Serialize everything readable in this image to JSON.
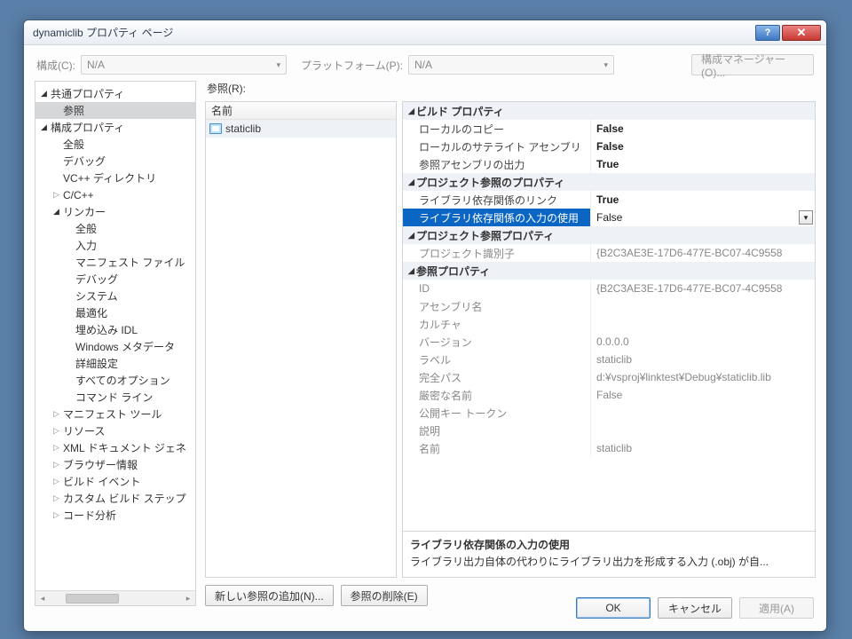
{
  "window": {
    "title": "dynamiclib プロパティ ページ"
  },
  "top": {
    "config_label": "構成(C):",
    "config_value": "N/A",
    "platform_label": "プラットフォーム(P):",
    "platform_value": "N/A",
    "configmgr": "構成マネージャー(O)..."
  },
  "tree": [
    {
      "d": 0,
      "exp": "exp",
      "label": "共通プロパティ"
    },
    {
      "d": 1,
      "exp": "none",
      "label": "参照",
      "sel": true
    },
    {
      "d": 0,
      "exp": "exp",
      "label": "構成プロパティ"
    },
    {
      "d": 1,
      "exp": "none",
      "label": "全般"
    },
    {
      "d": 1,
      "exp": "none",
      "label": "デバッグ"
    },
    {
      "d": 1,
      "exp": "none",
      "label": "VC++ ディレクトリ"
    },
    {
      "d": 1,
      "exp": "col",
      "label": "C/C++"
    },
    {
      "d": 1,
      "exp": "exp",
      "label": "リンカー"
    },
    {
      "d": 2,
      "exp": "none",
      "label": "全般"
    },
    {
      "d": 2,
      "exp": "none",
      "label": "入力"
    },
    {
      "d": 2,
      "exp": "none",
      "label": "マニフェスト ファイル"
    },
    {
      "d": 2,
      "exp": "none",
      "label": "デバッグ"
    },
    {
      "d": 2,
      "exp": "none",
      "label": "システム"
    },
    {
      "d": 2,
      "exp": "none",
      "label": "最適化"
    },
    {
      "d": 2,
      "exp": "none",
      "label": "埋め込み IDL"
    },
    {
      "d": 2,
      "exp": "none",
      "label": "Windows メタデータ"
    },
    {
      "d": 2,
      "exp": "none",
      "label": "詳細設定"
    },
    {
      "d": 2,
      "exp": "none",
      "label": "すべてのオプション"
    },
    {
      "d": 2,
      "exp": "none",
      "label": "コマンド ライン"
    },
    {
      "d": 1,
      "exp": "col",
      "label": "マニフェスト ツール"
    },
    {
      "d": 1,
      "exp": "col",
      "label": "リソース"
    },
    {
      "d": 1,
      "exp": "col",
      "label": "XML ドキュメント ジェネ"
    },
    {
      "d": 1,
      "exp": "col",
      "label": "ブラウザー情報"
    },
    {
      "d": 1,
      "exp": "col",
      "label": "ビルド イベント"
    },
    {
      "d": 1,
      "exp": "col",
      "label": "カスタム ビルド ステップ"
    },
    {
      "d": 1,
      "exp": "col",
      "label": "コード分析"
    }
  ],
  "refs": {
    "label": "参照(R):",
    "header": "名前",
    "items": [
      "staticlib"
    ]
  },
  "props": {
    "cats": [
      {
        "name": "ビルド プロパティ",
        "rows": [
          {
            "n": "ローカルのコピー",
            "v": "False",
            "b": true
          },
          {
            "n": "ローカルのサテライト アセンブリ",
            "v": "False",
            "b": true
          },
          {
            "n": "参照アセンブリの出力",
            "v": "True",
            "b": true
          }
        ]
      },
      {
        "name": "プロジェクト参照のプロパティ",
        "rows": [
          {
            "n": "ライブラリ依存関係のリンク",
            "v": "True",
            "b": true
          },
          {
            "n": "ライブラリ依存関係の入力の使用",
            "v": "False",
            "sel": true
          }
        ]
      },
      {
        "name": "プロジェクト参照プロパティ",
        "rows": [
          {
            "n": "プロジェクト識別子",
            "v": "{B2C3AE3E-17D6-477E-BC07-4C9558",
            "ro": true
          }
        ]
      },
      {
        "name": "参照プロパティ",
        "rows": [
          {
            "n": "ID",
            "v": "{B2C3AE3E-17D6-477E-BC07-4C9558",
            "ro": true
          },
          {
            "n": "アセンブリ名",
            "v": "",
            "ro": true
          },
          {
            "n": "カルチャ",
            "v": "",
            "ro": true
          },
          {
            "n": "バージョン",
            "v": "0.0.0.0",
            "ro": true
          },
          {
            "n": "ラベル",
            "v": "staticlib",
            "ro": true
          },
          {
            "n": "完全パス",
            "v": "d:¥vsproj¥linktest¥Debug¥staticlib.lib",
            "ro": true
          },
          {
            "n": "厳密な名前",
            "v": "False",
            "ro": true
          },
          {
            "n": "公開キー トークン",
            "v": "",
            "ro": true
          },
          {
            "n": "説明",
            "v": "",
            "ro": true
          },
          {
            "n": "名前",
            "v": "staticlib",
            "ro": true
          }
        ]
      }
    ]
  },
  "desc": {
    "title": "ライブラリ依存関係の入力の使用",
    "text": "ライブラリ出力自体の代わりにライブラリ出力を形成する入力 (.obj) が自..."
  },
  "buttons": {
    "addref": "新しい参照の追加(N)...",
    "remref": "参照の削除(E)",
    "ok": "OK",
    "cancel": "キャンセル",
    "apply": "適用(A)"
  }
}
